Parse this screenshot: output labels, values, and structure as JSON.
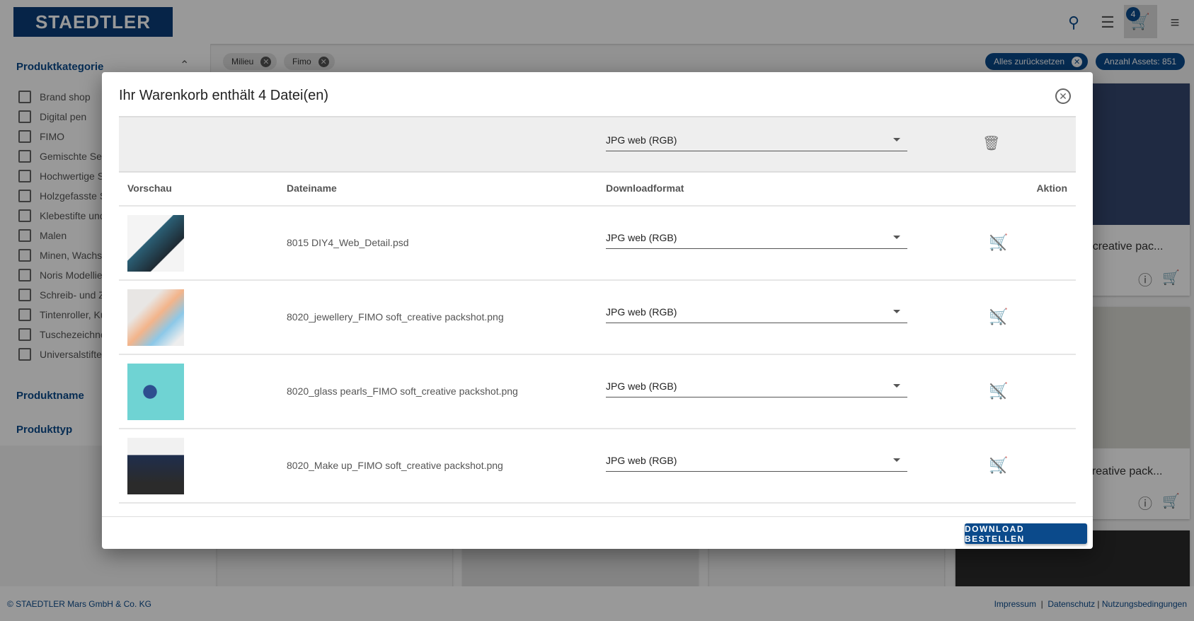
{
  "header": {
    "logo": "STAEDTLER",
    "cart_count": "4",
    "icons": [
      "search-icon",
      "list-icon",
      "cart-icon",
      "menu-icon"
    ]
  },
  "sidebar": {
    "category_title": "Produktkategorie",
    "categories": [
      "Brand shop",
      "Digital pen",
      "FIMO",
      "Gemischte Sets",
      "Hochwertige S",
      "Holzgefasste S",
      "Klebestifte und",
      "Malen",
      "Minen, Wachsm",
      "Noris Modellie",
      "Schreib- und Z",
      "Tintenroller, Ku",
      "Tuschezeichne",
      "Universalstifte"
    ],
    "name_title": "Produktname",
    "type_title": "Produkttyp"
  },
  "filters": {
    "chips": [
      "Milieu",
      "Fimo"
    ],
    "reset": "Alles zurücksetzen",
    "count": "Anzahl Assets: 851"
  },
  "background_cards": {
    "title1": "ft_creative pac...",
    "title2": "_creative pack..."
  },
  "modal": {
    "title": "Ihr Warenkorb enthält 4 Datei(en)",
    "bulk_format": "JPG web (RGB)",
    "columns": {
      "preview": "Vorschau",
      "filename": "Dateiname",
      "format": "Downloadformat",
      "action": "Aktion"
    },
    "rows": [
      {
        "filename": "8015 DIY4_Web_Detail.psd",
        "format": "JPG web (RGB)"
      },
      {
        "filename": "8020_jewellery_FIMO soft_creative packshot.png",
        "format": "JPG web (RGB)"
      },
      {
        "filename": "8020_glass pearls_FIMO soft_creative packshot.png",
        "format": "JPG web (RGB)"
      },
      {
        "filename": "8020_Make up_FIMO soft_creative packshot.png",
        "format": "JPG web (RGB)"
      }
    ],
    "download_button": "DOWNLOAD BESTELLEN"
  },
  "footer": {
    "copyright": "© STAEDTLER Mars GmbH & Co. KG",
    "links": [
      "Impressum",
      "Datenschutz",
      "Nutzungsbedingungen"
    ]
  },
  "colors": {
    "brand": "#0b4a8b"
  }
}
